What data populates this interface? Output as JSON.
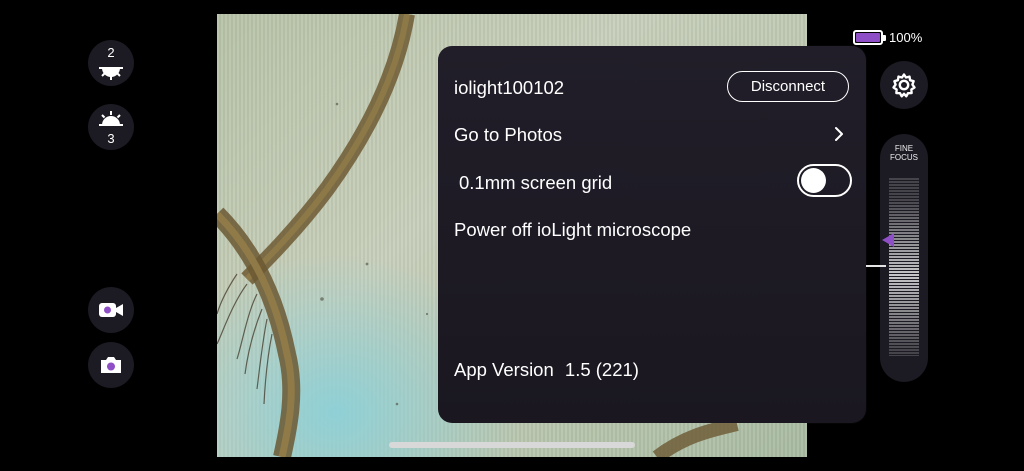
{
  "battery": {
    "percent_label": "100%",
    "level": 1.0,
    "color": "#8e4fc6"
  },
  "led_controls": {
    "top_led_level": "2",
    "bottom_led_level": "3"
  },
  "capture": {
    "video_icon": "video-camera-icon",
    "photo_icon": "camera-icon"
  },
  "focus": {
    "label_line1": "FINE",
    "label_line2": "FOCUS",
    "pointer_color": "#8e4fc6"
  },
  "settings_menu": {
    "device_name": "iolight100102",
    "disconnect_label": "Disconnect",
    "go_to_photos_label": "Go to Photos",
    "grid_label": "0.1mm screen grid",
    "grid_enabled": false,
    "power_off_label": "Power off ioLight microscope",
    "app_version_label": "App Version",
    "app_version_value": "1.5 (221)"
  }
}
